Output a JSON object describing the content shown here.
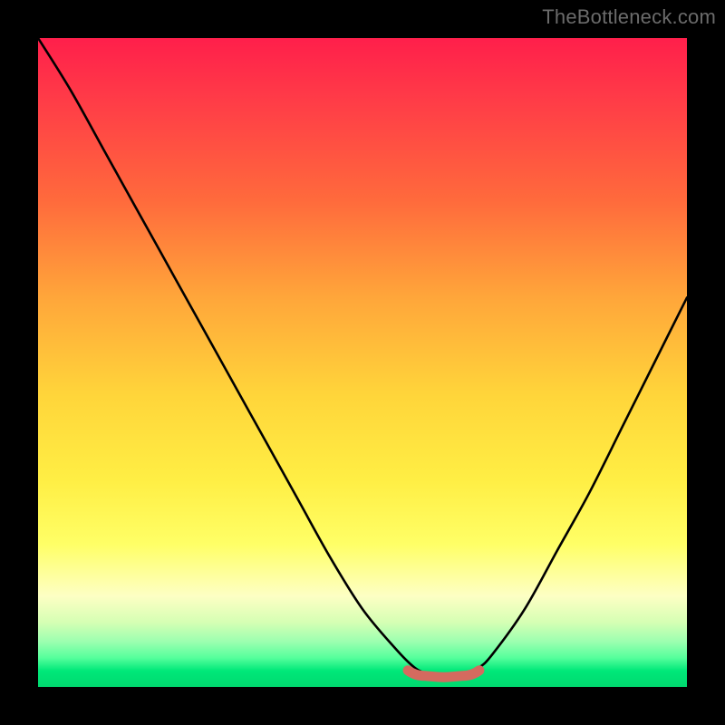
{
  "watermark": "TheBottleneck.com",
  "colors": {
    "frame": "#000000",
    "curve": "#000000",
    "bump": "#d46a5f"
  },
  "chart_data": {
    "type": "line",
    "title": "",
    "xlabel": "",
    "ylabel": "",
    "xlim": [
      0,
      100
    ],
    "ylim": [
      0,
      100
    ],
    "series": [
      {
        "name": "bottleneck-curve",
        "x": [
          0,
          5,
          10,
          15,
          20,
          25,
          30,
          35,
          40,
          45,
          50,
          55,
          58,
          60,
          62,
          64,
          66,
          68,
          70,
          75,
          80,
          85,
          90,
          95,
          100
        ],
        "y": [
          100,
          92,
          83,
          74,
          65,
          56,
          47,
          38,
          29,
          20,
          12,
          6,
          3,
          2,
          1.5,
          1.5,
          2,
          3,
          5,
          12,
          21,
          30,
          40,
          50,
          60
        ]
      }
    ],
    "annotations": [
      {
        "name": "optimal-range",
        "x_start": 57,
        "x_end": 68,
        "y": 2,
        "color": "#d46a5f"
      }
    ],
    "background_gradient": [
      {
        "stop": 0.0,
        "color": "#ff1f4b"
      },
      {
        "stop": 0.55,
        "color": "#ffd53a"
      },
      {
        "stop": 0.86,
        "color": "#fdffc4"
      },
      {
        "stop": 1.0,
        "color": "#00d96f"
      }
    ]
  }
}
